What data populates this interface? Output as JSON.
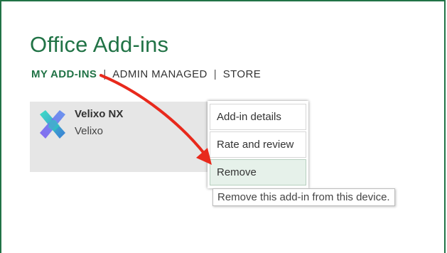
{
  "window": {
    "title": "Office Add-ins"
  },
  "nav": {
    "tabs": [
      {
        "label": "MY ADD-INS",
        "active": true
      },
      {
        "label": "ADMIN MANAGED",
        "active": false
      },
      {
        "label": "STORE",
        "active": false
      }
    ]
  },
  "addin": {
    "name": "Velixo NX",
    "publisher": "Velixo",
    "icon": "velixo-logo-icon"
  },
  "context_menu": {
    "items": [
      {
        "label": "Add-in details"
      },
      {
        "label": "Rate and review"
      },
      {
        "label": "Remove",
        "highlighted": true
      }
    ]
  },
  "tooltip": {
    "text": "Remove this add-in from this device."
  },
  "annotation": {
    "arrow_color": "#e8291c"
  },
  "colors": {
    "accent": "#217346",
    "tile_bg": "#e6e6e6",
    "hover_bg": "#e6f1ea"
  }
}
